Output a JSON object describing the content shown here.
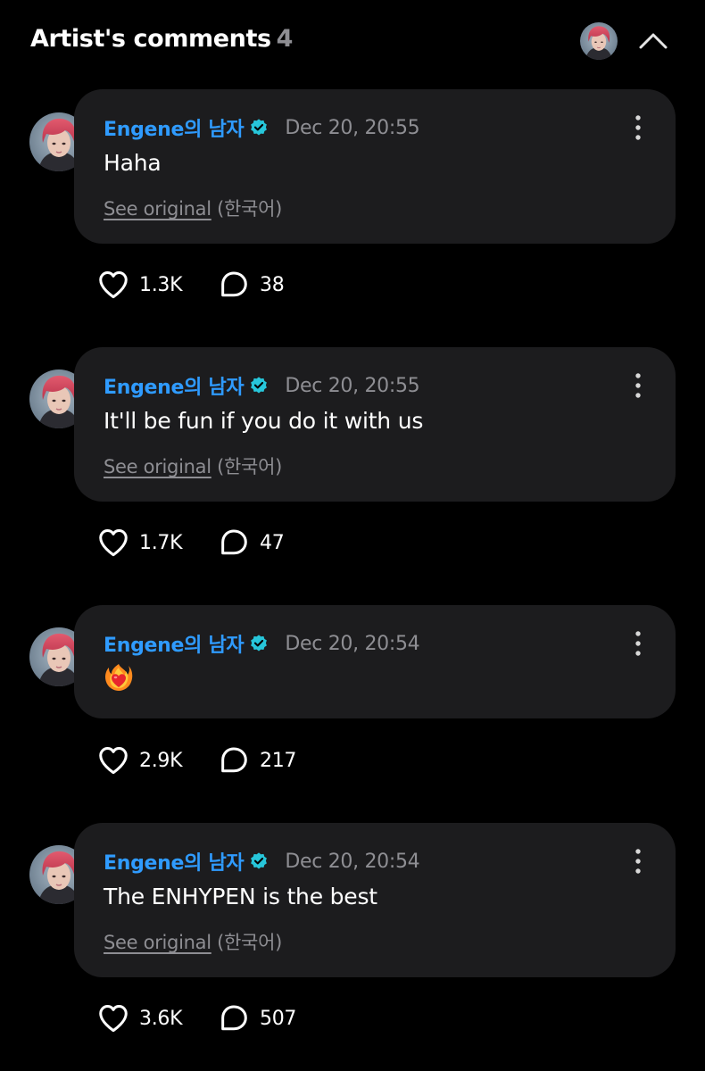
{
  "header": {
    "title": "Artist's comments",
    "count": "4"
  },
  "comments": [
    {
      "author": "Engene의 남자",
      "timestamp": "Dec 20, 20:55",
      "text": "Haha",
      "see_original": "See original",
      "language": "(한국어)",
      "likes": "1.3K",
      "replies": "38"
    },
    {
      "author": "Engene의 남자",
      "timestamp": "Dec 20, 20:55",
      "text": "It'll be fun if you do it with us",
      "see_original": "See original",
      "language": "(한국어)",
      "likes": "1.7K",
      "replies": "47"
    },
    {
      "author": "Engene의 남자",
      "timestamp": "Dec 20, 20:54",
      "emoji": "heart-on-fire-emoji",
      "likes": "2.9K",
      "replies": "217"
    },
    {
      "author": "Engene의 남자",
      "timestamp": "Dec 20, 20:54",
      "text": "The ENHYPEN is the best",
      "see_original": "See original",
      "language": "(한국어)",
      "likes": "3.6K",
      "replies": "507"
    }
  ],
  "icons": {
    "verified": "verified-badge-icon",
    "more": "more-vertical-icon",
    "like": "heart-outline-icon",
    "reply": "speech-bubble-icon",
    "collapse": "chevron-up-icon"
  },
  "colors": {
    "background": "#000000",
    "bubble": "#1c1c1e",
    "author": "#2f9bff",
    "verified": "#27c6da",
    "muted": "#8e8e93",
    "text": "#ffffff"
  }
}
